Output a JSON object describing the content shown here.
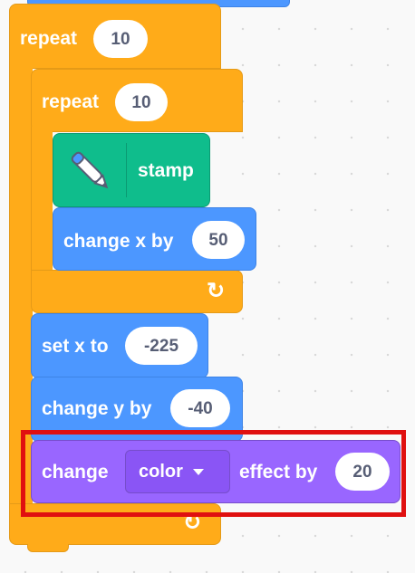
{
  "outer_repeat": {
    "label": "repeat",
    "count": "10"
  },
  "inner_repeat": {
    "label": "repeat",
    "count": "10"
  },
  "stamp_block": {
    "label": "stamp",
    "icon": "pen-icon"
  },
  "change_x": {
    "label": "change x by",
    "value": "50"
  },
  "set_x": {
    "label": "set x to",
    "value": "-225"
  },
  "change_y": {
    "label": "change y by",
    "value": "-40"
  },
  "change_effect": {
    "label_prefix": "change",
    "effect": "color",
    "label_suffix": "effect by",
    "value": "20"
  },
  "loop_arrow_icon": "↻",
  "colors": {
    "control": "#ffab19",
    "motion": "#4c97ff",
    "pen": "#0fbd8c",
    "looks": "#9966ff",
    "highlight": "#e01010"
  }
}
